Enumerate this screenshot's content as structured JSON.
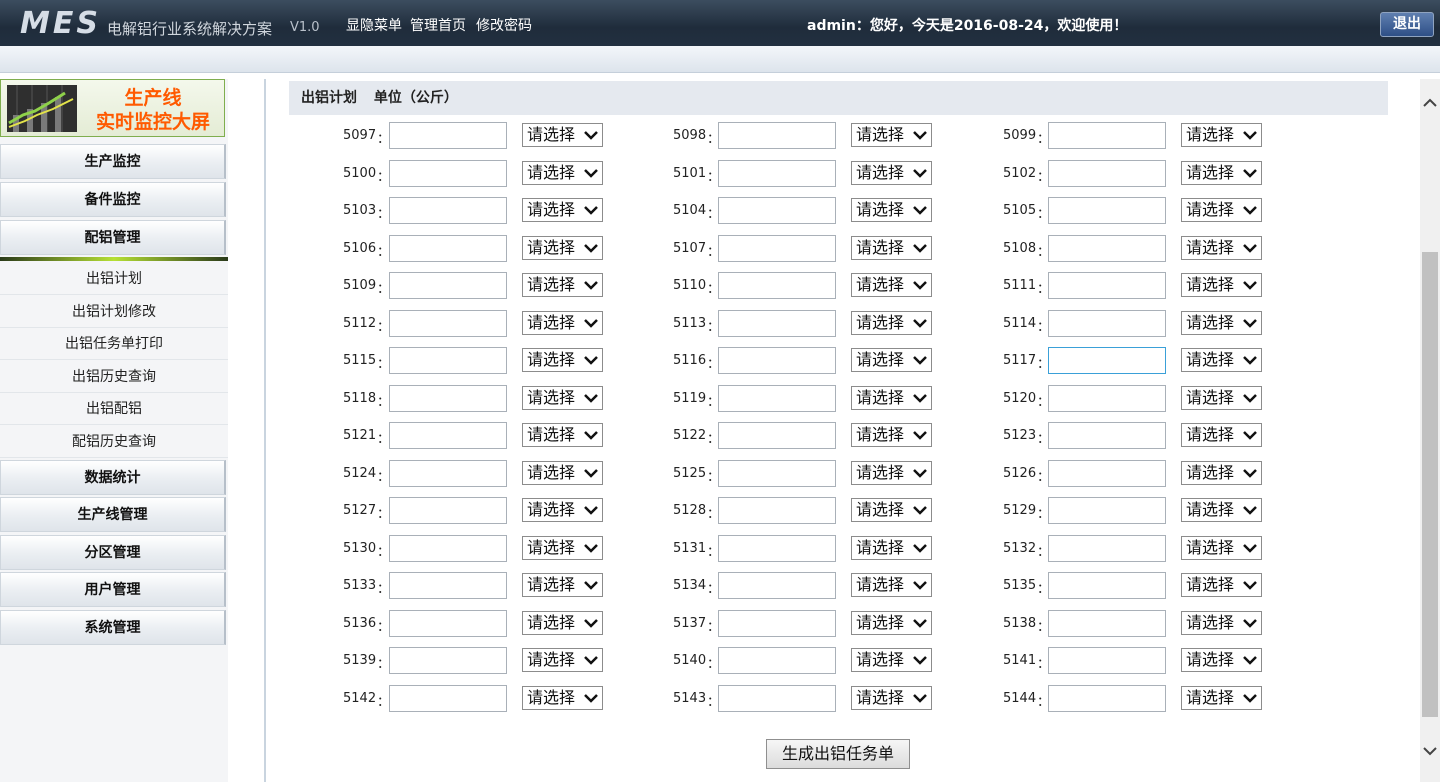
{
  "header": {
    "logo": "MES",
    "subtitle": "电解铝行业系统解决方案",
    "version": "V1.0",
    "menu": [
      "显隐菜单",
      "管理首页",
      "修改密码"
    ],
    "welcome": "admin：您好，今天是2016-08-24，欢迎使用！",
    "logout_label": "退出"
  },
  "sidebar": {
    "banner_line1": "生产线",
    "banner_line2": "实时监控大屏",
    "nav_top": [
      "生产监控",
      "备件监控",
      "配铝管理"
    ],
    "sub_items": [
      "出铝计划",
      "出铝计划修改",
      "出铝任务单打印",
      "出铝历史查询",
      "出铝配铝",
      "配铝历史查询"
    ],
    "nav_bottom": [
      "数据统计",
      "生产线管理",
      "分区管理",
      "用户管理",
      "系统管理"
    ]
  },
  "main": {
    "section_title": "出铝计划",
    "unit_label": "单位（公斤）",
    "select_placeholder": "请选择",
    "rows": [
      [
        "5097",
        "5098",
        "5099"
      ],
      [
        "5100",
        "5101",
        "5102"
      ],
      [
        "5103",
        "5104",
        "5105"
      ],
      [
        "5106",
        "5107",
        "5108"
      ],
      [
        "5109",
        "5110",
        "5111"
      ],
      [
        "5112",
        "5113",
        "5114"
      ],
      [
        "5115",
        "5116",
        "5117"
      ],
      [
        "5118",
        "5119",
        "5120"
      ],
      [
        "5121",
        "5122",
        "5123"
      ],
      [
        "5124",
        "5125",
        "5126"
      ],
      [
        "5127",
        "5128",
        "5129"
      ],
      [
        "5130",
        "5131",
        "5132"
      ],
      [
        "5133",
        "5134",
        "5135"
      ],
      [
        "5136",
        "5137",
        "5138"
      ],
      [
        "5139",
        "5140",
        "5141"
      ],
      [
        "5142",
        "5143",
        "5144"
      ]
    ],
    "active_field": "5117",
    "generate_button": "生成出铝任务单"
  },
  "colors": {
    "header_bg": "#223040",
    "banner_text": "#ff5a00",
    "active_border": "#3aa0d8"
  }
}
